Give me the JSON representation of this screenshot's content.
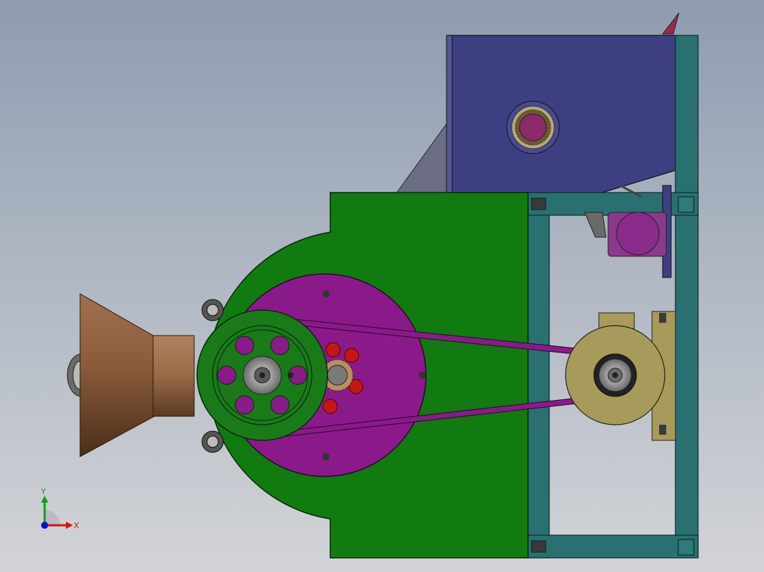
{
  "viewport": {
    "background_top": "#8e9bb0",
    "background_bottom": "#d2d4d7"
  },
  "colors": {
    "housing": "#117a11",
    "frame": "#2a7070",
    "hopper_box": "#3e3f82",
    "rotor_disc": "#8a1a8a",
    "pulley": "#1a7a1a",
    "belt": "#8a1a8a",
    "motor": "#a89a5a",
    "funnel": "#8a5a3a",
    "bearing_red": "#c01818"
  },
  "triad": {
    "x_label": "X",
    "y_label": "Y",
    "x_color": "#e01010",
    "y_color": "#10a010",
    "z_color": "#1010d0"
  }
}
